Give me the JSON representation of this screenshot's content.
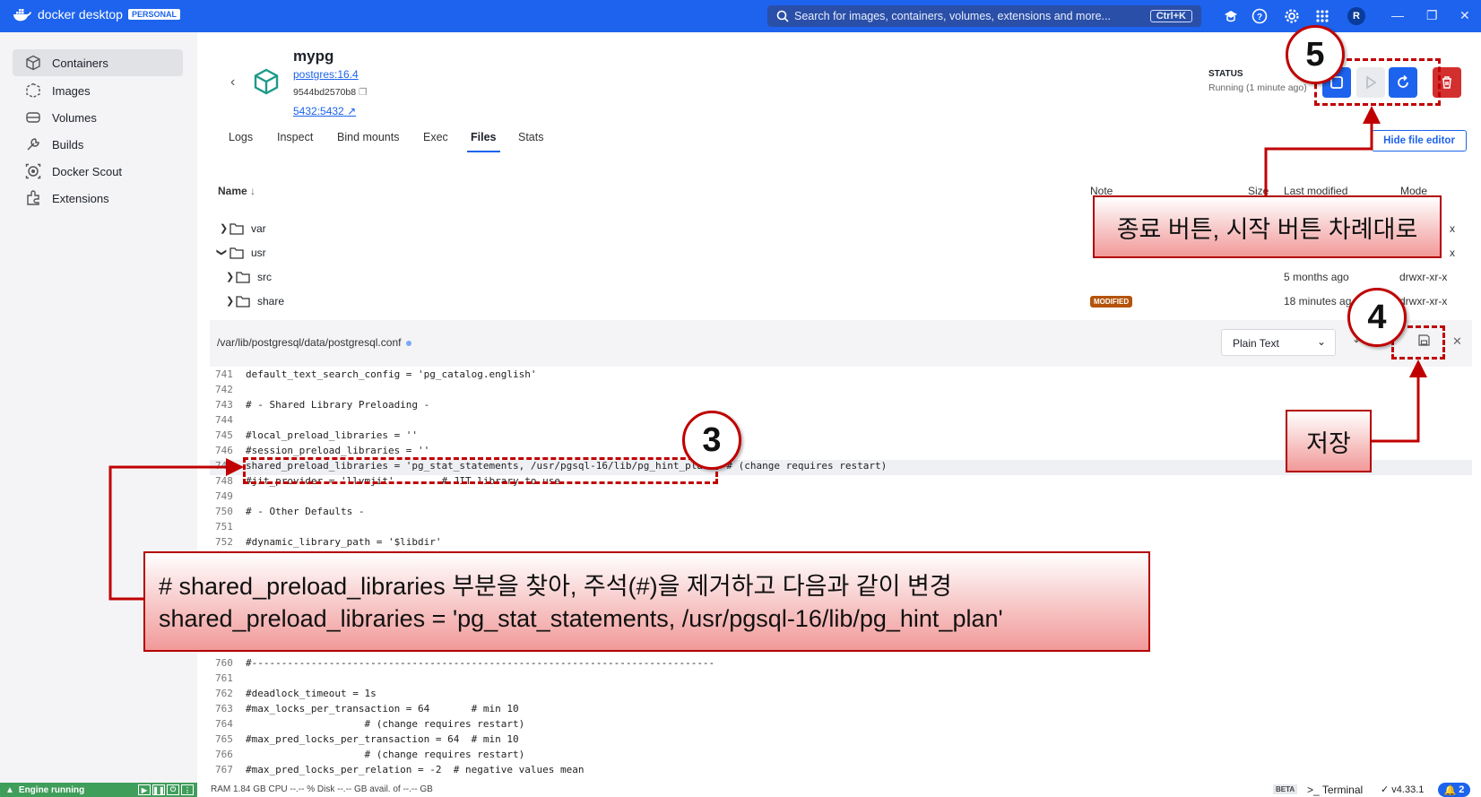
{
  "app": {
    "brand": "docker desktop",
    "plan": "PERSONAL",
    "search_placeholder": "Search for images, containers, volumes, extensions and more...",
    "search_shortcut": "Ctrl+K",
    "user_initial": "R",
    "accent_color": "#1d63ed"
  },
  "sidebar": {
    "items": [
      {
        "label": "Containers",
        "icon": "containers-icon"
      },
      {
        "label": "Images",
        "icon": "images-icon"
      },
      {
        "label": "Volumes",
        "icon": "volumes-icon"
      },
      {
        "label": "Builds",
        "icon": "builds-icon"
      },
      {
        "label": "Docker Scout",
        "icon": "scout-icon"
      },
      {
        "label": "Extensions",
        "icon": "extensions-icon"
      }
    ],
    "engine_status": "Engine running"
  },
  "container": {
    "name": "mypg",
    "image": "postgres:16.4",
    "id": "9544bd2570b8",
    "ports": "5432:5432",
    "status_label": "STATUS",
    "status_value": "Running (1 minute ago)",
    "hide_editor_label": "Hide file editor"
  },
  "tabs": [
    "Logs",
    "Inspect",
    "Bind mounts",
    "Exec",
    "Files",
    "Stats"
  ],
  "active_tab": "Files",
  "file_table": {
    "headers": {
      "name": "Name",
      "note": "Note",
      "size": "Size",
      "last_modified": "Last modified",
      "mode": "Mode"
    },
    "rows": [
      {
        "name": "var",
        "expanded": false,
        "last_modified": "",
        "mode": "x"
      },
      {
        "name": "usr",
        "expanded": true,
        "last_modified": "",
        "mode": "x"
      },
      {
        "name": "src",
        "expanded": false,
        "last_modified": "5 months ago",
        "mode": "drwxr-xr-x"
      },
      {
        "name": "share",
        "expanded": false,
        "note": "MODIFIED",
        "last_modified": "18 minutes ag",
        "mode": "drwxr-xr-x"
      }
    ]
  },
  "editor": {
    "path": "/var/lib/postgresql/data/postgresql.conf",
    "language": "Plain Text",
    "lines": [
      {
        "n": "741",
        "t": "default_text_search_config = 'pg_catalog.english'"
      },
      {
        "n": "742",
        "t": ""
      },
      {
        "n": "743",
        "t": "# - Shared Library Preloading -"
      },
      {
        "n": "744",
        "t": ""
      },
      {
        "n": "745",
        "t": "#local_preload_libraries = ''"
      },
      {
        "n": "746",
        "t": "#session_preload_libraries = ''"
      },
      {
        "n": "747",
        "t": "shared_preload_libraries = 'pg_stat_statements, /usr/pgsql-16/lib/pg_hint_plan'  # (change requires restart)"
      },
      {
        "n": "748",
        "t": "#jit_provider = 'llvmjit'        # JIT library to use"
      },
      {
        "n": "749",
        "t": ""
      },
      {
        "n": "750",
        "t": "# - Other Defaults -"
      },
      {
        "n": "751",
        "t": ""
      },
      {
        "n": "752",
        "t": "#dynamic_library_path = '$libdir'"
      },
      {
        "n": "760",
        "t": "#------------------------------------------------------------------------------"
      },
      {
        "n": "761",
        "t": ""
      },
      {
        "n": "762",
        "t": "#deadlock_timeout = 1s"
      },
      {
        "n": "763",
        "t": "#max_locks_per_transaction = 64       # min 10"
      },
      {
        "n": "764",
        "t": "                    # (change requires restart)"
      },
      {
        "n": "765",
        "t": "#max_pred_locks_per_transaction = 64  # min 10"
      },
      {
        "n": "766",
        "t": "                    # (change requires restart)"
      },
      {
        "n": "767",
        "t": "#max_pred_locks_per_relation = -2  # negative values mean"
      }
    ]
  },
  "statusbar": {
    "resources": "RAM 1.84 GB   CPU --.-- %     Disk --.-- GB avail. of --.-- GB",
    "beta": "BETA",
    "terminal": "Terminal",
    "version": "v4.33.1",
    "notifications": "2"
  },
  "annotations": {
    "step3": "3",
    "step4": "4",
    "step5": "5",
    "callout_buttons": "종료 버튼, 시작 버튼 차례대로",
    "callout_save": "저장",
    "callout_edit_line1": "# shared_preload_libraries 부분을 찾아, 주석(#)을 제거하고 다음과 같이 변경",
    "callout_edit_line2": "shared_preload_libraries = 'pg_stat_statements, /usr/pgsql-16/lib/pg_hint_plan'",
    "highlight_color": "#c00000"
  }
}
